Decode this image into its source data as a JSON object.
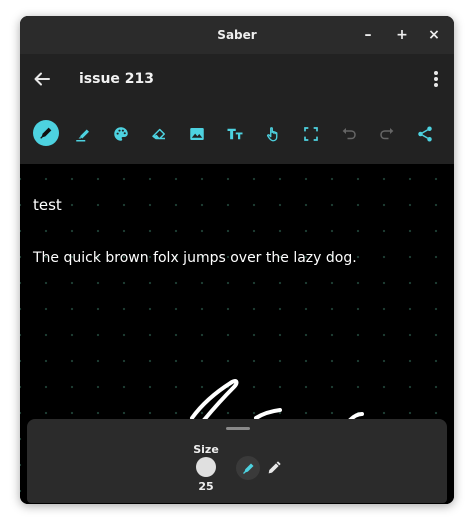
{
  "window": {
    "title": "Saber",
    "minimize_glyph": "–",
    "maximize_glyph": "+",
    "close_glyph": "×"
  },
  "appbar": {
    "back_icon": "arrow-left-icon",
    "title": "issue 213",
    "menu_icon": "more-vert-icon"
  },
  "toolbar": {
    "accent": "#4dd2e0",
    "tools": [
      "fountain-pen (selected)",
      "highlighter",
      "palette",
      "eraser",
      "image",
      "text",
      "hand",
      "select",
      "undo (disabled)",
      "redo (disabled)",
      "share"
    ]
  },
  "canvas": {
    "text_lines": [
      "test",
      "The quick brown folx jumps over the lazy dog."
    ]
  },
  "pen_panel": {
    "size_label": "Size",
    "size_value": "25",
    "pens": [
      "fountain-pen (selected)",
      "ballpoint-pen"
    ]
  }
}
